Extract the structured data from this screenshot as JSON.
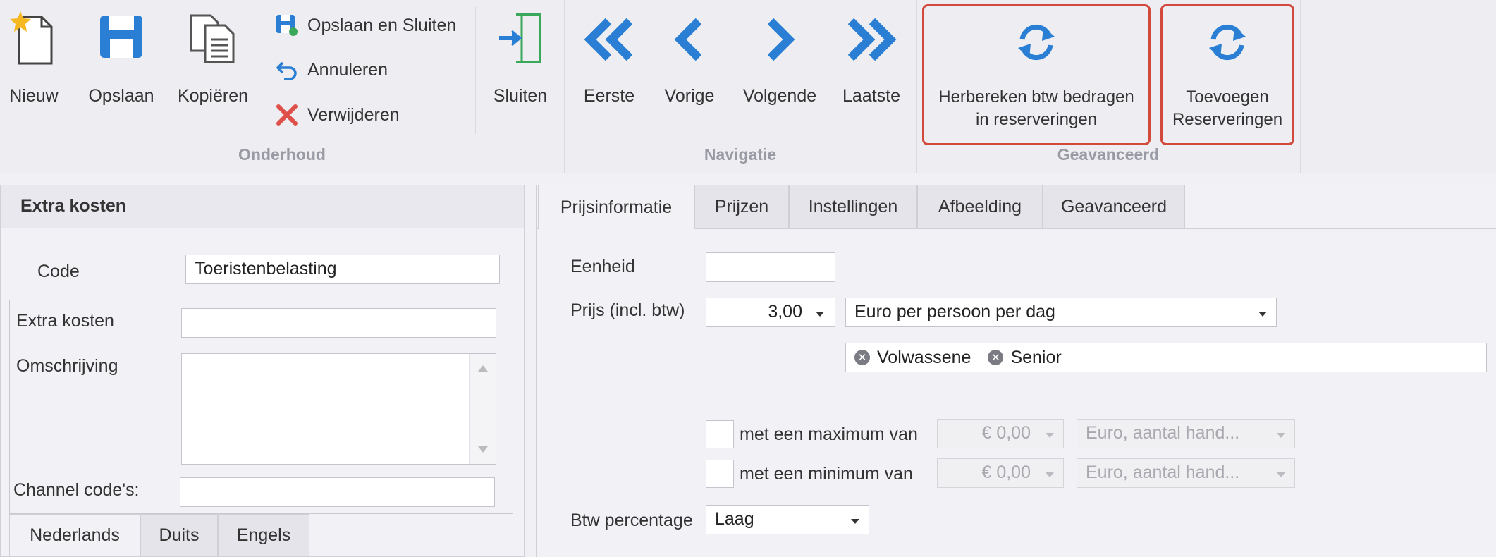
{
  "ribbon": {
    "groups": {
      "onderhoud": "Onderhoud",
      "navigatie": "Navigatie",
      "geavanceerd": "Geavanceerd"
    },
    "buttons": {
      "nieuw": "Nieuw",
      "opslaan": "Opslaan",
      "kopieren": "Kopiëren",
      "opslaan_sluiten": "Opslaan en Sluiten",
      "annuleren": "Annuleren",
      "verwijderen": "Verwijderen",
      "sluiten": "Sluiten",
      "eerste": "Eerste",
      "vorige": "Vorige",
      "volgende": "Volgende",
      "laatste": "Laatste",
      "herbereken_line1": "Herbereken btw bedragen",
      "herbereken_line2": "in reserveringen",
      "toevoegen_line1": "Toevoegen",
      "toevoegen_line2": "Reserveringen"
    }
  },
  "left": {
    "title": "Extra kosten",
    "code_label": "Code",
    "code_value": "Toeristenbelasting",
    "extra_kosten_label": "Extra kosten",
    "extra_kosten_value": "",
    "omschrijving_label": "Omschrijving",
    "omschrijving_value": "",
    "channel_label": "Channel code's:",
    "channel_value": "",
    "lang_tabs": [
      "Nederlands",
      "Duits",
      "Engels"
    ]
  },
  "right": {
    "tabs": [
      "Prijsinformatie",
      "Prijzen",
      "Instellingen",
      "Afbeelding",
      "Geavanceerd"
    ],
    "eenheid_label": "Eenheid",
    "eenheid_value": "",
    "prijs_label": "Prijs (incl. btw)",
    "prijs_value": "3,00",
    "prijs_type": "Euro per persoon per dag",
    "chips": [
      "Volwassene",
      "Senior"
    ],
    "max_label": "met een maximum van",
    "max_value": "€ 0,00",
    "max_unit": "Euro, aantal hand...",
    "min_label": "met een minimum van",
    "min_value": "€ 0,00",
    "min_unit": "Euro, aantal hand...",
    "btw_label": "Btw percentage",
    "btw_value": "Laag"
  },
  "colors": {
    "icon_blue": "#2a7fd4",
    "highlight_red": "#d24a3c",
    "delete_red": "#e0504a",
    "star_yellow": "#f5b820"
  }
}
